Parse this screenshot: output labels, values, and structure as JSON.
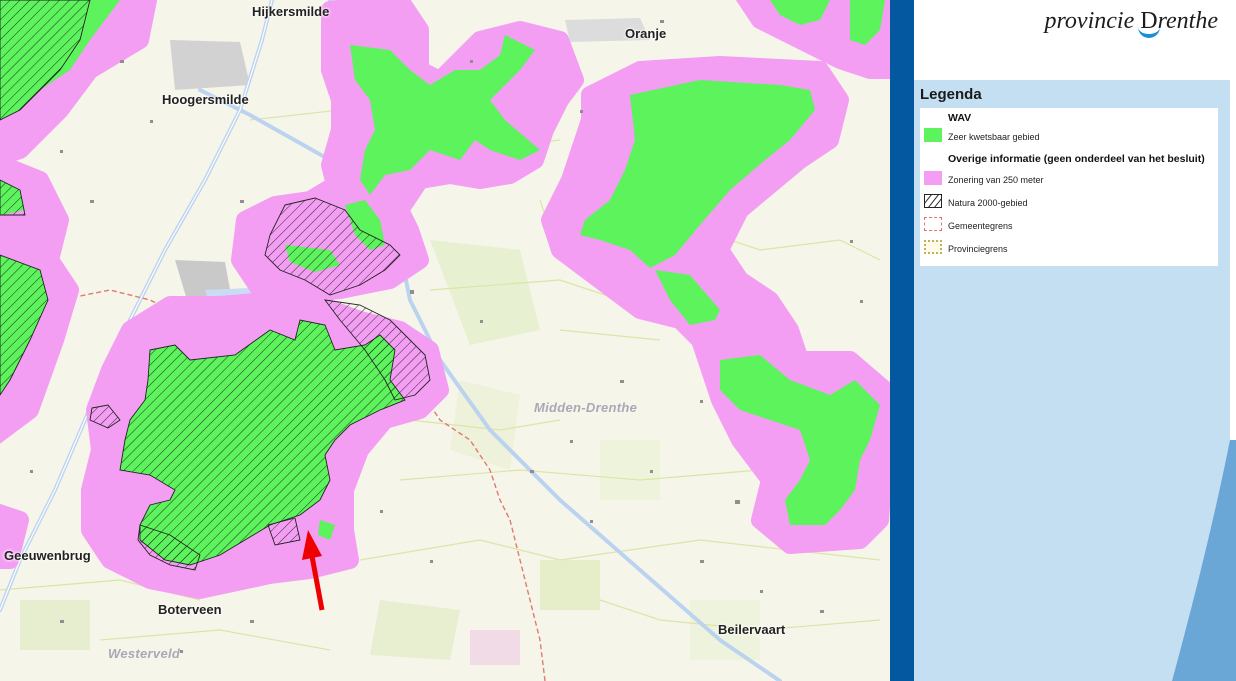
{
  "header": {
    "logo_text_1": "provincie ",
    "logo_text_d": "D",
    "logo_text_2": "renthe"
  },
  "legend": {
    "title": "Legenda",
    "sections": [
      {
        "heading": "WAV",
        "items": [
          {
            "label": "Zeer kwetsbaar gebied",
            "symbol": "green-fill",
            "color": "#5cf35c"
          }
        ]
      },
      {
        "heading": "Overige informatie (geen onderdeel van het besluit)",
        "items": [
          {
            "label": "Zonering van 250 meter",
            "symbol": "pink-fill",
            "color": "#f39ef3"
          },
          {
            "label": "Natura 2000-gebied",
            "symbol": "hatch-outline",
            "color": "#222222"
          },
          {
            "label": "Gemeentegrens",
            "symbol": "dashed-red-outline",
            "color": "#e07a6e"
          },
          {
            "label": "Provinciegrens",
            "symbol": "dotted-olive-outline",
            "color": "#b9b36a"
          }
        ]
      }
    ]
  },
  "map": {
    "places": [
      "Hijkersmilde",
      "Oranje",
      "Hoogersmilde",
      "Geeuwenbrug",
      "Boterveen",
      "Beilervaart"
    ],
    "municipalities": [
      "Midden-Drenthe",
      "Westerveld"
    ],
    "marker": "red-arrow"
  },
  "colors": {
    "wav_green": "#5cf35c",
    "zone_pink": "#f39ef3",
    "accent_blue": "#04589f",
    "legend_bg": "#c4dff1",
    "arrow_red": "#ee0000"
  }
}
